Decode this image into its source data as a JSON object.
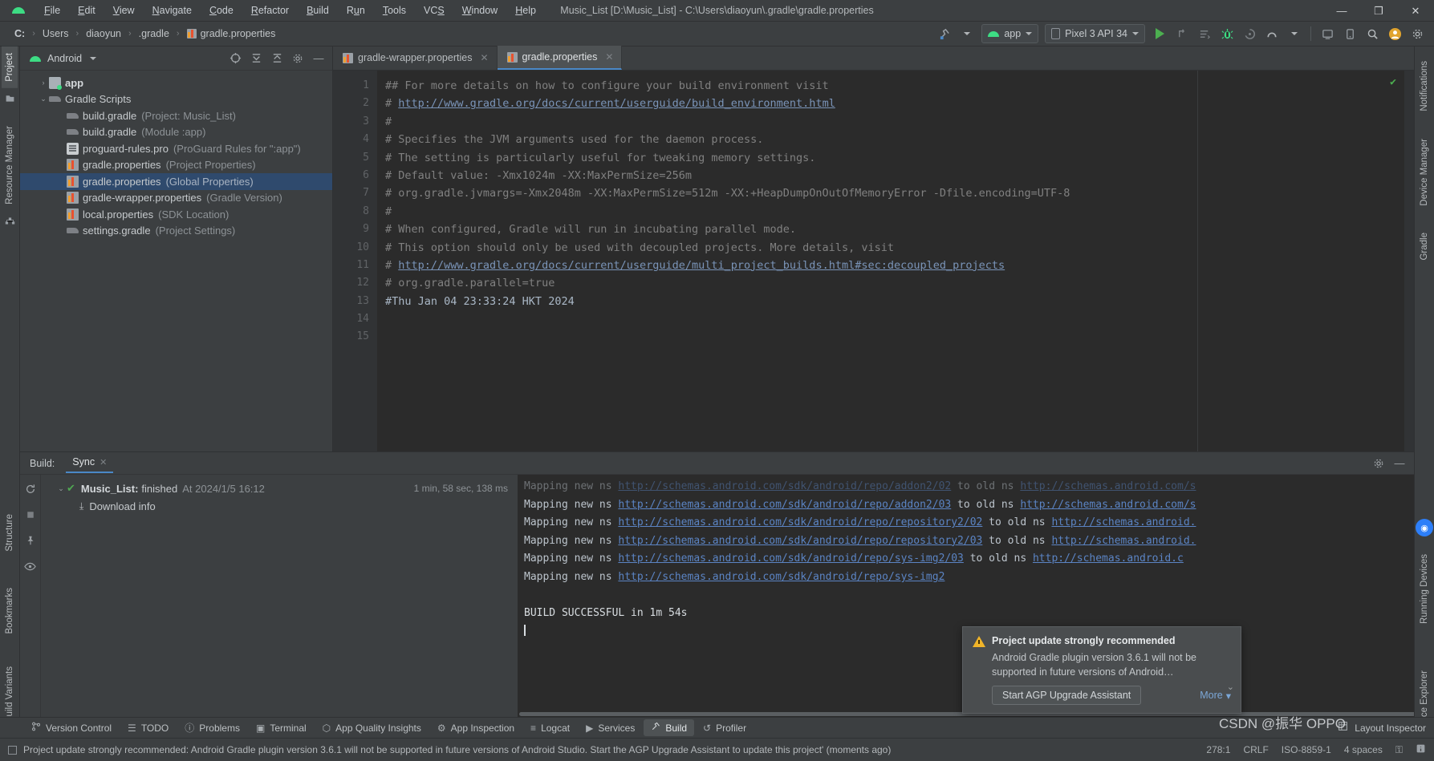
{
  "window": {
    "title": "Music_List [D:\\Music_List] - C:\\Users\\diaoyun\\.gradle\\gradle.properties",
    "minimize": "—",
    "maximize": "❐",
    "close": "✕"
  },
  "menu": {
    "items": [
      "File",
      "Edit",
      "View",
      "Navigate",
      "Code",
      "Refactor",
      "Build",
      "Run",
      "Tools",
      "VCS",
      "Window",
      "Help"
    ]
  },
  "breadcrumb": {
    "items": [
      "C:",
      "Users",
      "diaoyun",
      ".gradle",
      "gradle.properties"
    ],
    "separator": "›"
  },
  "toolbar": {
    "sync_icon": "gradle-sync-icon",
    "run_config": "app",
    "device": "Pixel 3 API 34",
    "run": "▶",
    "rerun": "↻",
    "apply_changes": "≡",
    "debug": "debug-icon",
    "profile": "profile-icon",
    "more": "▾",
    "search": "⌕",
    "avatar": "user-avatar",
    "settings": "⚙"
  },
  "left_strip": {
    "tabs": [
      "Project",
      "Resource Manager"
    ],
    "bottom_tabs": [
      "Structure",
      "Bookmarks",
      "Build Variants"
    ]
  },
  "right_strip": {
    "tabs": [
      "Notifications",
      "Device Manager",
      "Gradle",
      "Running Devices",
      "Device Explorer"
    ]
  },
  "project_panel": {
    "title": "Android",
    "actions": [
      "target-icon",
      "expand-all-icon",
      "collapse-all-icon",
      "settings-icon",
      "hide-icon"
    ],
    "tree": [
      {
        "indent": 0,
        "arrow": "›",
        "icon": "folder",
        "name": "app",
        "bold": true,
        "meta": "",
        "selected": false
      },
      {
        "indent": 0,
        "arrow": "⌄",
        "icon": "gradle",
        "name": "Gradle Scripts",
        "bold": false,
        "meta": "",
        "selected": false
      },
      {
        "indent": 1,
        "arrow": "",
        "icon": "gradle",
        "name": "build.gradle",
        "bold": false,
        "meta": "(Project: Music_List)",
        "selected": false
      },
      {
        "indent": 1,
        "arrow": "",
        "icon": "gradle",
        "name": "build.gradle",
        "bold": false,
        "meta": "(Module :app)",
        "selected": false
      },
      {
        "indent": 1,
        "arrow": "",
        "icon": "pro",
        "name": "proguard-rules.pro",
        "bold": false,
        "meta": "(ProGuard Rules for \":app\")",
        "selected": false
      },
      {
        "indent": 1,
        "arrow": "",
        "icon": "props",
        "name": "gradle.properties",
        "bold": false,
        "meta": "(Project Properties)",
        "selected": false
      },
      {
        "indent": 1,
        "arrow": "",
        "icon": "props",
        "name": "gradle.properties",
        "bold": false,
        "meta": "(Global Properties)",
        "selected": true
      },
      {
        "indent": 1,
        "arrow": "",
        "icon": "props",
        "name": "gradle-wrapper.properties",
        "bold": false,
        "meta": "(Gradle Version)",
        "selected": false
      },
      {
        "indent": 1,
        "arrow": "",
        "icon": "props",
        "name": "local.properties",
        "bold": false,
        "meta": "(SDK Location)",
        "selected": false
      },
      {
        "indent": 1,
        "arrow": "",
        "icon": "gradle",
        "name": "settings.gradle",
        "bold": false,
        "meta": "(Project Settings)",
        "selected": false
      }
    ]
  },
  "editor": {
    "tabs": [
      {
        "label": "gradle-wrapper.properties",
        "active": false,
        "close": "✕"
      },
      {
        "label": "gradle.properties",
        "active": true,
        "close": "✕"
      }
    ],
    "lines": [
      {
        "n": 1,
        "text": "## For more details on how to configure your build environment visit",
        "link": false
      },
      {
        "n": 2,
        "text": "# http://www.gradle.org/docs/current/userguide/build_environment.html",
        "link": true,
        "link_start": 2
      },
      {
        "n": 3,
        "text": "#",
        "link": false
      },
      {
        "n": 4,
        "text": "# Specifies the JVM arguments used for the daemon process.",
        "link": false
      },
      {
        "n": 5,
        "text": "# The setting is particularly useful for tweaking memory settings.",
        "link": false
      },
      {
        "n": 6,
        "text": "# Default value: -Xmx1024m -XX:MaxPermSize=256m",
        "link": false
      },
      {
        "n": 7,
        "text": "# org.gradle.jvmargs=-Xmx2048m -XX:MaxPermSize=512m -XX:+HeapDumpOnOutOfMemoryError -Dfile.encoding=UTF-8",
        "link": false
      },
      {
        "n": 8,
        "text": "#",
        "link": false
      },
      {
        "n": 9,
        "text": "# When configured, Gradle will run in incubating parallel mode.",
        "link": false
      },
      {
        "n": 10,
        "text": "# This option should only be used with decoupled projects. More details, visit",
        "link": false
      },
      {
        "n": 11,
        "text": "# http://www.gradle.org/docs/current/userguide/multi_project_builds.html#sec:decoupled_projects",
        "link": true,
        "link_start": 2
      },
      {
        "n": 12,
        "text": "# org.gradle.parallel=true",
        "link": false
      },
      {
        "n": 13,
        "text": "#Thu Jan 04 23:33:24 HKT 2024",
        "link": false,
        "plain": true
      },
      {
        "n": 14,
        "text": "",
        "link": false
      },
      {
        "n": 15,
        "text": "",
        "link": false
      }
    ],
    "status_ok": "✔"
  },
  "build_panel": {
    "label": "Build:",
    "tab": "Sync",
    "tab_close": "✕",
    "actions": [
      "settings-icon",
      "minimize-icon"
    ],
    "gutter_buttons": [
      "restart-icon",
      "stop-icon",
      "pin-icon",
      "eye-icon"
    ],
    "tree": {
      "arrow": "⌄",
      "check": "✔",
      "name": "Music_List:",
      "status": "finished",
      "time": "At 2024/1/5 16:12",
      "duration": "1 min, 58 sec, 138 ms",
      "child_icon": "⤓",
      "child_label": "Download info"
    },
    "console": [
      {
        "pre": "Mapping new ns ",
        "url": "http://schemas.android.com/sdk/android/repo/addon2/02",
        "mid": " to old ns ",
        "url2": "http://schemas.android.com/s",
        "faded": true
      },
      {
        "pre": "Mapping new ns ",
        "url": "http://schemas.android.com/sdk/android/repo/addon2/03",
        "mid": " to old ns ",
        "url2": "http://schemas.android.com/s",
        "faded": false
      },
      {
        "pre": "Mapping new ns ",
        "url": "http://schemas.android.com/sdk/android/repo/repository2/02",
        "mid": " to old ns ",
        "url2": "http://schemas.android.",
        "faded": false
      },
      {
        "pre": "Mapping new ns ",
        "url": "http://schemas.android.com/sdk/android/repo/repository2/03",
        "mid": " to old ns ",
        "url2": "http://schemas.android.",
        "faded": false
      },
      {
        "pre": "Mapping new ns ",
        "url": "http://schemas.android.com/sdk/android/repo/sys-img2/03",
        "mid": " to old ns ",
        "url2": "http://schemas.android.c",
        "faded": false
      },
      {
        "pre": "Mapping new ns ",
        "url": "http://schemas.android.com/sdk/android/repo/sys-img2",
        "mid": "",
        "url2": "",
        "faded": false
      }
    ],
    "build_result": "BUILD SUCCESSFUL in 1m 54s"
  },
  "notification": {
    "title": "Project update strongly recommended",
    "body": "Android Gradle plugin version 3.6.1 will not be supported in future versions of Android…",
    "primary_button": "Start AGP Upgrade Assistant",
    "more_label": "More",
    "more_caret": "▾",
    "collapse": "⌄",
    "warning_icon": "warning-triangle-icon"
  },
  "bottom_tools": {
    "items": [
      {
        "icon": "⑂",
        "label": "Version Control"
      },
      {
        "icon": "☰",
        "label": "TODO"
      },
      {
        "icon": "ⓘ",
        "label": "Problems"
      },
      {
        "icon": "▣",
        "label": "Terminal"
      },
      {
        "icon": "⬡",
        "label": "App Quality Insights"
      },
      {
        "icon": "⚙",
        "label": "App Inspection"
      },
      {
        "icon": "≡",
        "label": "Logcat"
      },
      {
        "icon": "▶",
        "label": "Services"
      },
      {
        "icon": "⚒",
        "label": "Build",
        "active": true
      },
      {
        "icon": "↺",
        "label": "Profiler"
      }
    ],
    "layout_label": "Layout Inspector"
  },
  "status_bar": {
    "message": "Project update strongly recommended: Android Gradle plugin version 3.6.1 will not be supported in future versions of Android Studio. Start the AGP Upgrade Assistant to update this project' (moments ago)",
    "caret_position": "278:1",
    "line_separator": "CRLF",
    "encoding": "ISO-8859-1",
    "indent": "4 spaces",
    "lock_icon": "⚿",
    "event_icon": "ℹ"
  },
  "watermark": {
    "text": "CSDN @振华 OPPO",
    "sub": "Layout Inspector"
  },
  "colors": {
    "accent_blue": "#4a88c7",
    "selection_blue": "#2f4a6d",
    "green": "#3ddc84",
    "warn_yellow": "#f0b429",
    "link_blue": "#5b84c4",
    "panel_bg": "#3c3f41",
    "editor_bg": "#2b2b2b"
  }
}
